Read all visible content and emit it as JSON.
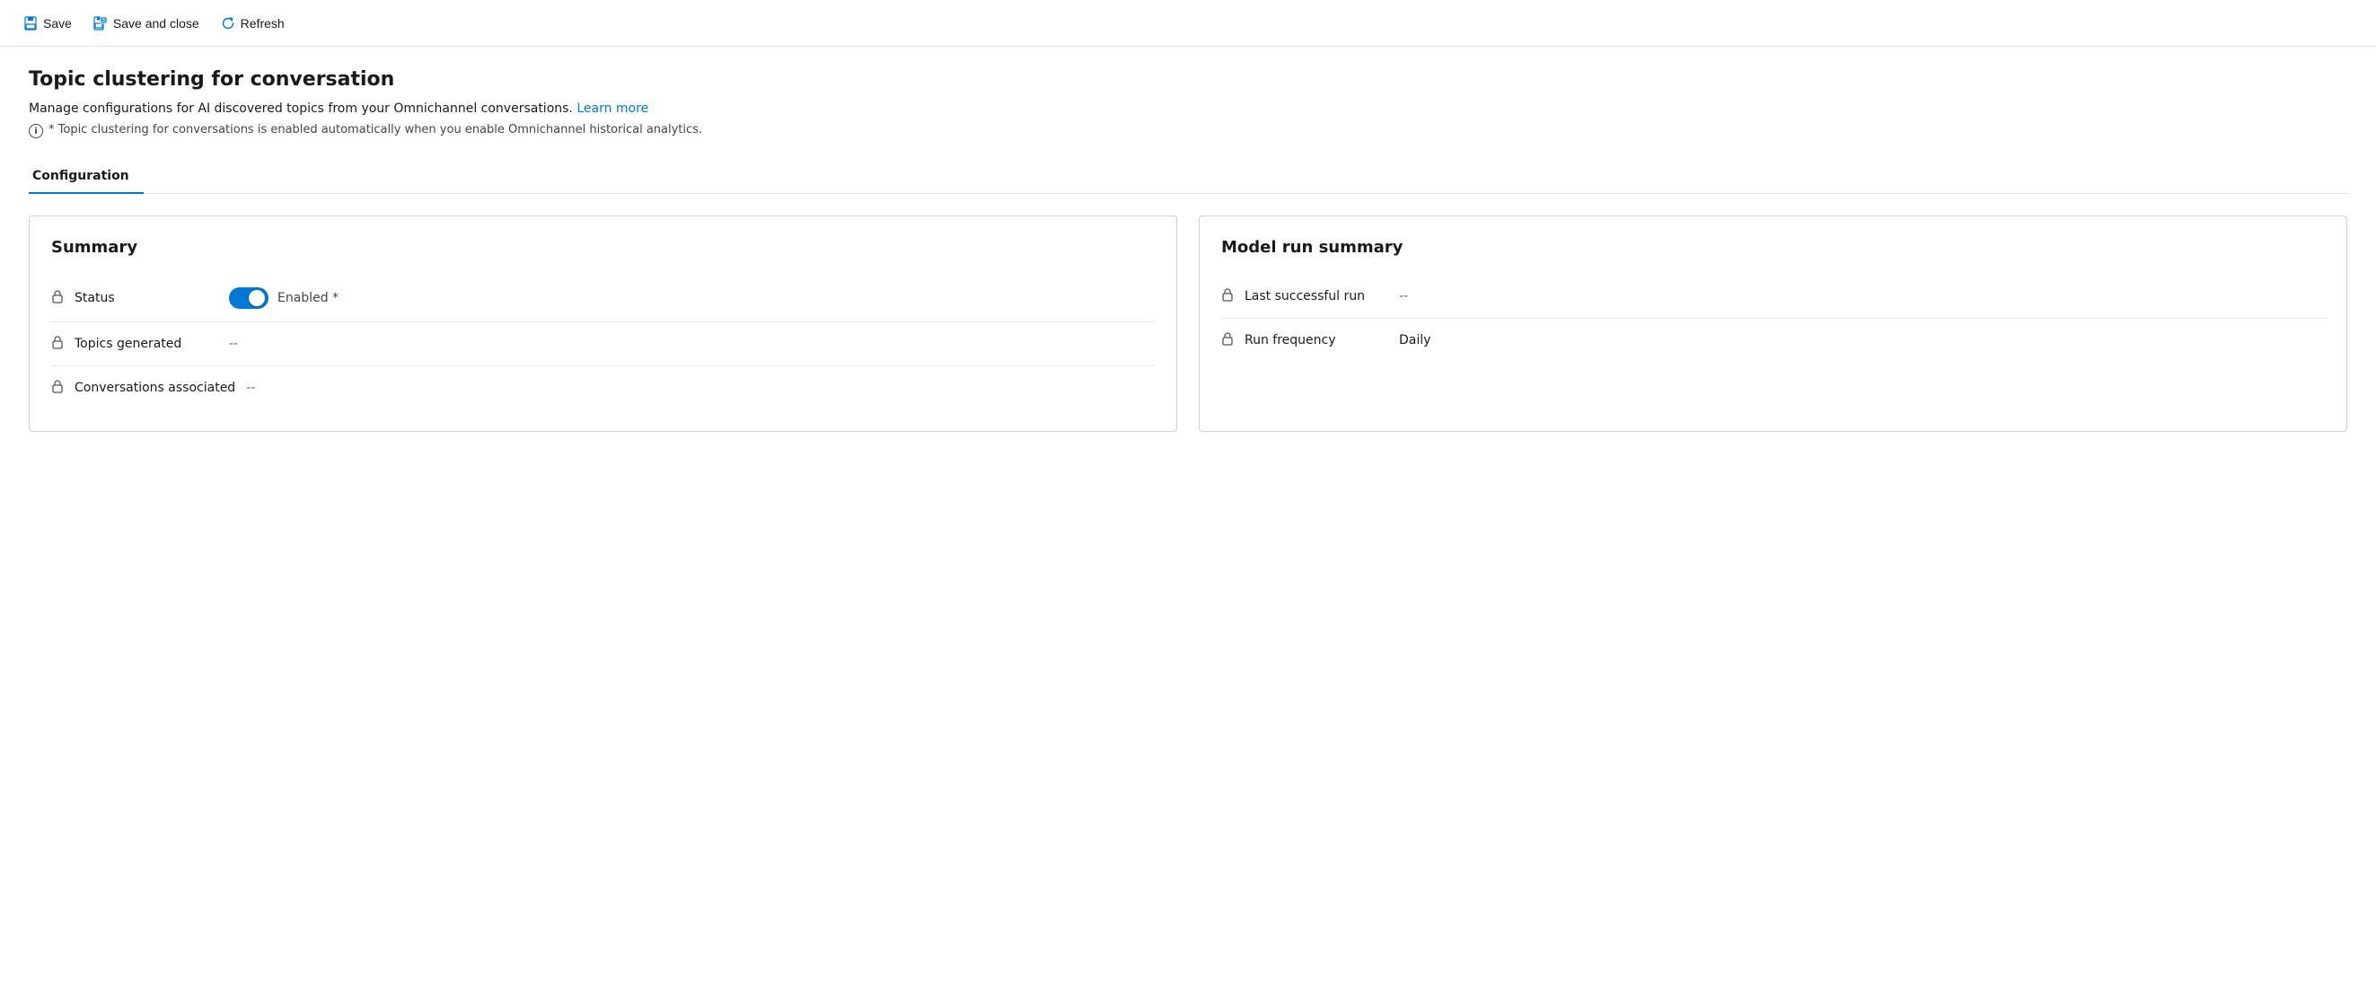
{
  "toolbar": {
    "save_label": "Save",
    "save_close_label": "Save and close",
    "refresh_label": "Refresh"
  },
  "page": {
    "title": "Topic clustering for conversation",
    "description": "Manage configurations for AI discovered topics from your Omnichannel conversations.",
    "learn_more_label": "Learn more",
    "info_note": "* Topic clustering for conversations is enabled automatically when you enable Omnichannel historical analytics."
  },
  "tabs": [
    {
      "label": "Configuration",
      "active": true
    }
  ],
  "summary_card": {
    "title": "Summary",
    "fields": [
      {
        "label": "Status",
        "type": "toggle",
        "toggle_state": "enabled",
        "toggle_label": "Enabled *"
      },
      {
        "label": "Topics generated",
        "value": "--"
      },
      {
        "label": "Conversations associated",
        "value": "--"
      }
    ]
  },
  "model_run_card": {
    "title": "Model run summary",
    "fields": [
      {
        "label": "Last successful run",
        "value": "--"
      },
      {
        "label": "Run frequency",
        "value": "Daily"
      }
    ]
  }
}
